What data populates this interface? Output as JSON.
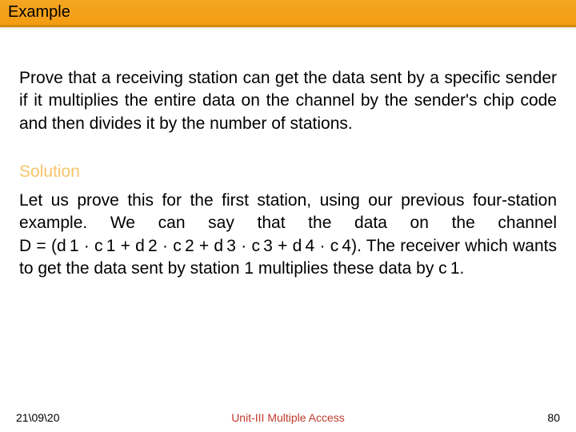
{
  "title": "Example",
  "problem": "Prove that a receiving station can get the data sent by a specific sender if it multiplies the entire data on the channel by the sender's chip code and then divides it by the number of stations.",
  "solution_label": "Solution",
  "solution_text": "Let us prove this for the first station, using our previous four-station example. We can say that the data on the channel D = (d 1 · c 1 + d 2 · c 2 + d 3 · c 3 + d 4 · c 4). The receiver which wants to get the data sent by station 1 multiplies these data by c 1.",
  "footer": {
    "date": "21\\09\\20",
    "unit": "Unit-III Multiple Access",
    "page": "80"
  }
}
